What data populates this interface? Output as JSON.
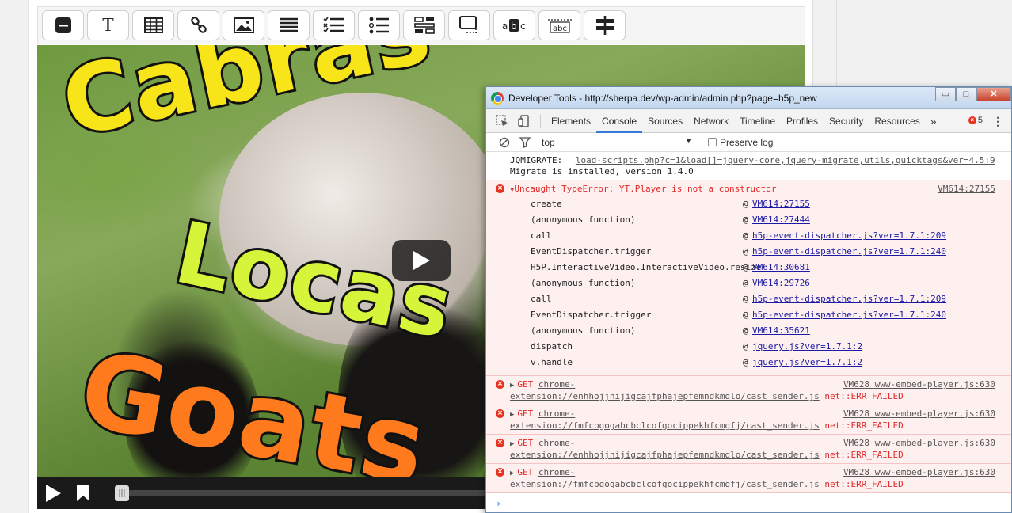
{
  "toolbar": {
    "buttons": [
      "label",
      "text",
      "table",
      "link",
      "image",
      "statements",
      "single-choice",
      "multiple-choice",
      "drag-and-drop",
      "navigation-hotspot",
      "fill-in-blanks",
      "drag-text"
    ],
    "text_label": "T"
  },
  "video": {
    "title_words": [
      "Cabras",
      "Locas",
      "Goats"
    ],
    "colors": {
      "cabras": "#f7e51a",
      "locas": "#d6f53a",
      "goats": "#ff7a1c"
    }
  },
  "devtools": {
    "title": "Developer Tools - http://sherpa.dev/wp-admin/admin.php?page=h5p_new",
    "tabs": [
      "Elements",
      "Console",
      "Sources",
      "Network",
      "Timeline",
      "Profiles",
      "Security",
      "Resources"
    ],
    "active_tab": "Console",
    "more_label": "»",
    "error_count": "5",
    "context": "top",
    "preserve_log_label": "Preserve log",
    "window_buttons": {
      "minimize": "▭",
      "maximize": "□",
      "close": "✕"
    }
  },
  "console": {
    "jqmigrate": {
      "prefix": "JQMIGRATE:",
      "link": "load-scripts.php?c=1&load[]=jquery-core,jquery-migrate,utils,quicktags&ver=4.5:9",
      "line2": "Migrate is installed, version 1.4.0"
    },
    "type_error": {
      "message": "Uncaught TypeError: YT.Player is not a constructor",
      "source": "VM614:27155",
      "stack": [
        {
          "fn": "create",
          "src": "VM614:27155"
        },
        {
          "fn": "(anonymous function)",
          "src": "VM614:27444"
        },
        {
          "fn": "call",
          "src": "h5p-event-dispatcher.js?ver=1.7.1:209"
        },
        {
          "fn": "EventDispatcher.trigger",
          "src": "h5p-event-dispatcher.js?ver=1.7.1:240"
        },
        {
          "fn": "H5P.InteractiveVideo.InteractiveVideo.resize",
          "src": "VM614:30681"
        },
        {
          "fn": "(anonymous function)",
          "src": "VM614:29726"
        },
        {
          "fn": "call",
          "src": "h5p-event-dispatcher.js?ver=1.7.1:209"
        },
        {
          "fn": "EventDispatcher.trigger",
          "src": "h5p-event-dispatcher.js?ver=1.7.1:240"
        },
        {
          "fn": "(anonymous function)",
          "src": "VM614:35621"
        },
        {
          "fn": "dispatch",
          "src": "jquery.js?ver=1.7.1:2"
        },
        {
          "fn": "v.handle",
          "src": "jquery.js?ver=1.7.1:2"
        }
      ]
    },
    "get_errors": [
      {
        "method": "GET",
        "url1": "chrome-",
        "url2": "extension://enhhojjnijigcajfphajepfemndkmdlo/cast_sender.js",
        "source": "VM628 www-embed-player.js:630",
        "status": "net::ERR_FAILED"
      },
      {
        "method": "GET",
        "url1": "chrome-",
        "url2": "extension://fmfcbgogabcbclcofgocippekhfcmgfj/cast_sender.js",
        "source": "VM628 www-embed-player.js:630",
        "status": "net::ERR_FAILED"
      },
      {
        "method": "GET",
        "url1": "chrome-",
        "url2": "extension://enhhojjnijigcajfphajepfemndkmdlo/cast_sender.js",
        "source": "VM628 www-embed-player.js:630",
        "status": "net::ERR_FAILED"
      },
      {
        "method": "GET",
        "url1": "chrome-",
        "url2": "extension://fmfcbgogabcbclcofgocippekhfcmgfj/cast_sender.js",
        "source": "VM628 www-embed-player.js:630",
        "status": "net::ERR_FAILED"
      }
    ],
    "prompt_symbol": "›",
    "stack_at": "@"
  }
}
